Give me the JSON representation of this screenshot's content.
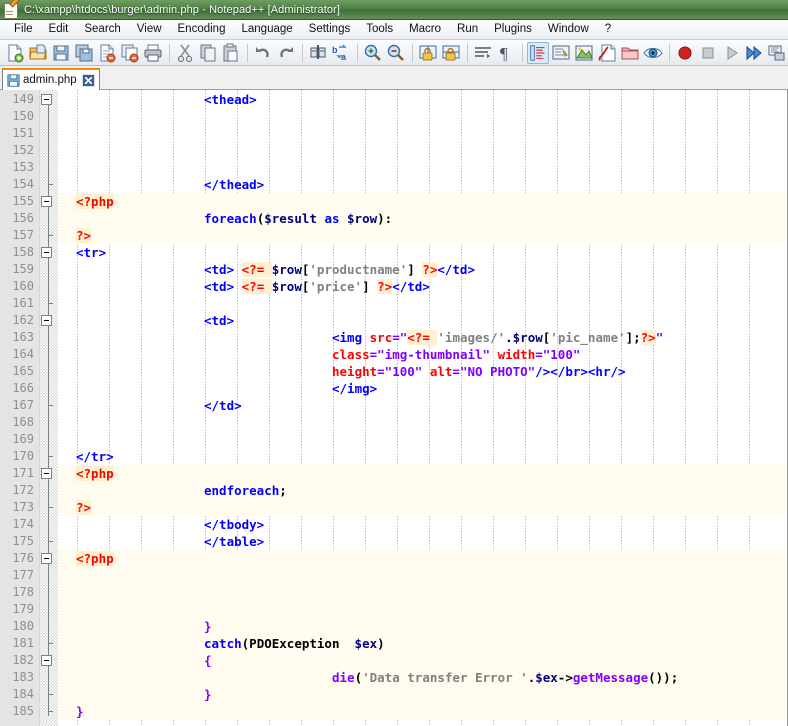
{
  "window": {
    "title": "C:\\xampp\\htdocs\\burger\\admin.php - Notepad++ [Administrator]",
    "app_icon": "notepad-plus-plus-icon",
    "titlebar_color": "#4e7f43"
  },
  "menubar": {
    "items": [
      {
        "label": "File",
        "name": "menu-file"
      },
      {
        "label": "Edit",
        "name": "menu-edit"
      },
      {
        "label": "Search",
        "name": "menu-search"
      },
      {
        "label": "View",
        "name": "menu-view"
      },
      {
        "label": "Encoding",
        "name": "menu-encoding"
      },
      {
        "label": "Language",
        "name": "menu-language"
      },
      {
        "label": "Settings",
        "name": "menu-settings"
      },
      {
        "label": "Tools",
        "name": "menu-tools"
      },
      {
        "label": "Macro",
        "name": "menu-macro"
      },
      {
        "label": "Run",
        "name": "menu-run"
      },
      {
        "label": "Plugins",
        "name": "menu-plugins"
      },
      {
        "label": "Window",
        "name": "menu-window"
      },
      {
        "label": "?",
        "name": "menu-help"
      }
    ]
  },
  "toolbar": {
    "buttons": [
      "new-file-icon",
      "open-file-icon",
      "save-icon",
      "save-all-icon",
      "close-file-icon",
      "close-all-files-icon",
      "print-icon",
      "sep",
      "cut-icon",
      "copy-icon",
      "paste-icon",
      "sep",
      "undo-icon",
      "redo-icon",
      "sep",
      "find-icon",
      "replace-icon",
      "sep",
      "zoom-in-icon",
      "zoom-out-icon",
      "sep",
      "sync-vertical-scroll-icon",
      "sync-horizontal-scroll-icon",
      "sep",
      "word-wrap-icon",
      "show-all-characters-icon",
      "sep",
      "indent-guide-icon",
      "user-defined-language-icon",
      "show-doc-map-icon",
      "function-list-icon",
      "folder-as-workspace-icon",
      "monitoring-icon",
      "sep",
      "record-macro-icon",
      "stop-recording-icon",
      "playback-icon",
      "run-macro-multiple-icon",
      "save-macro-icon",
      "sep",
      "run-icon"
    ]
  },
  "tabs": {
    "active_index": 0,
    "items": [
      {
        "label": "admin.php",
        "icon": "saved-file-icon",
        "close_icon": "close-tab-icon"
      }
    ]
  },
  "editor": {
    "first_line": 149,
    "fold_lines": [
      149,
      155,
      158,
      162,
      171,
      176,
      182
    ],
    "tick_lines": [
      154,
      157,
      161,
      167,
      170,
      173,
      175,
      181,
      184,
      185
    ],
    "php_background_lines": [
      155,
      156,
      157,
      171,
      172,
      173,
      176,
      177,
      178,
      179,
      180,
      181,
      182,
      183,
      184,
      185
    ],
    "lines": [
      {
        "n": 149,
        "indent": 4,
        "tokens": [
          {
            "t": "tag",
            "v": "<thead>"
          }
        ]
      },
      {
        "n": 150,
        "indent": 0,
        "tokens": []
      },
      {
        "n": 151,
        "indent": 0,
        "tokens": []
      },
      {
        "n": 152,
        "indent": 0,
        "tokens": []
      },
      {
        "n": 153,
        "indent": 0,
        "tokens": []
      },
      {
        "n": 154,
        "indent": 4,
        "tokens": [
          {
            "t": "tag",
            "v": "</thead>"
          }
        ]
      },
      {
        "n": 155,
        "indent": 0,
        "tokens": [
          {
            "t": "phptag",
            "v": "<?php"
          }
        ]
      },
      {
        "n": 156,
        "indent": 4,
        "tokens": [
          {
            "t": "kw",
            "v": "foreach"
          },
          {
            "t": "op",
            "v": "("
          },
          {
            "t": "var",
            "v": "$result"
          },
          {
            "t": "plain",
            "v": " "
          },
          {
            "t": "kw",
            "v": "as"
          },
          {
            "t": "plain",
            "v": " "
          },
          {
            "t": "var",
            "v": "$row"
          },
          {
            "t": "op",
            "v": "):"
          }
        ]
      },
      {
        "n": 157,
        "indent": 0,
        "tokens": [
          {
            "t": "phptag",
            "v": "?>"
          }
        ]
      },
      {
        "n": 158,
        "indent": 0,
        "tokens": [
          {
            "t": "tag",
            "v": "<tr>"
          }
        ]
      },
      {
        "n": 159,
        "indent": 4,
        "tokens": [
          {
            "t": "tag",
            "v": "<td> "
          },
          {
            "t": "phptag",
            "v": "<?= "
          },
          {
            "t": "var",
            "v": "$row"
          },
          {
            "t": "op",
            "v": "["
          },
          {
            "t": "str",
            "v": "'productname'"
          },
          {
            "t": "op",
            "v": "] "
          },
          {
            "t": "phptag",
            "v": "?>"
          },
          {
            "t": "tag",
            "v": "</td>"
          }
        ]
      },
      {
        "n": 160,
        "indent": 4,
        "tokens": [
          {
            "t": "tag",
            "v": "<td> "
          },
          {
            "t": "phptag",
            "v": "<?= "
          },
          {
            "t": "var",
            "v": "$row"
          },
          {
            "t": "op",
            "v": "["
          },
          {
            "t": "str",
            "v": "'price'"
          },
          {
            "t": "op",
            "v": "] "
          },
          {
            "t": "phptag",
            "v": "?>"
          },
          {
            "t": "tag",
            "v": "</td>"
          }
        ]
      },
      {
        "n": 161,
        "indent": 0,
        "tokens": []
      },
      {
        "n": 162,
        "indent": 4,
        "tokens": [
          {
            "t": "tag",
            "v": "<td>"
          }
        ]
      },
      {
        "n": 163,
        "indent": 8,
        "tokens": [
          {
            "t": "tag",
            "v": "<img "
          },
          {
            "t": "attr",
            "v": "src"
          },
          {
            "t": "attrval",
            "v": "=\""
          },
          {
            "t": "phptag",
            "v": "<?= "
          },
          {
            "t": "str",
            "v": "'images/'"
          },
          {
            "t": "op",
            "v": "."
          },
          {
            "t": "var",
            "v": "$row"
          },
          {
            "t": "op",
            "v": "["
          },
          {
            "t": "str",
            "v": "'pic_name'"
          },
          {
            "t": "op",
            "v": "];"
          },
          {
            "t": "phptag",
            "v": "?>"
          },
          {
            "t": "attrval",
            "v": "\""
          }
        ]
      },
      {
        "n": 164,
        "indent": 8,
        "tokens": [
          {
            "t": "attr",
            "v": "class"
          },
          {
            "t": "attrval",
            "v": "=\"img-thumbnail\""
          },
          {
            "t": "plain",
            "v": " "
          },
          {
            "t": "attr",
            "v": "width"
          },
          {
            "t": "attrval",
            "v": "=\"100\""
          }
        ]
      },
      {
        "n": 165,
        "indent": 8,
        "tokens": [
          {
            "t": "attr",
            "v": "height"
          },
          {
            "t": "attrval",
            "v": "=\"100\""
          },
          {
            "t": "plain",
            "v": " "
          },
          {
            "t": "attr",
            "v": "alt"
          },
          {
            "t": "attrval",
            "v": "=\"NO PHOTO\""
          },
          {
            "t": "tag",
            "v": "/></br><hr/>"
          }
        ]
      },
      {
        "n": 166,
        "indent": 8,
        "tokens": [
          {
            "t": "tag",
            "v": "</img>"
          }
        ]
      },
      {
        "n": 167,
        "indent": 4,
        "tokens": [
          {
            "t": "tag",
            "v": "</td>"
          }
        ]
      },
      {
        "n": 168,
        "indent": 0,
        "tokens": []
      },
      {
        "n": 169,
        "indent": 0,
        "tokens": []
      },
      {
        "n": 170,
        "indent": 0,
        "tokens": [
          {
            "t": "tag",
            "v": "</tr>"
          }
        ]
      },
      {
        "n": 171,
        "indent": 0,
        "tokens": [
          {
            "t": "phptag",
            "v": "<?php"
          }
        ]
      },
      {
        "n": 172,
        "indent": 4,
        "tokens": [
          {
            "t": "kw",
            "v": "endforeach"
          },
          {
            "t": "op",
            "v": ";"
          }
        ]
      },
      {
        "n": 173,
        "indent": 0,
        "tokens": [
          {
            "t": "phptag",
            "v": "?>"
          }
        ]
      },
      {
        "n": 174,
        "indent": 4,
        "tokens": [
          {
            "t": "tag",
            "v": "</tbody>"
          }
        ]
      },
      {
        "n": 175,
        "indent": 4,
        "tokens": [
          {
            "t": "tag",
            "v": "</table>"
          }
        ]
      },
      {
        "n": 176,
        "indent": 0,
        "tokens": [
          {
            "t": "phptag",
            "v": "<?php"
          }
        ]
      },
      {
        "n": 177,
        "indent": 0,
        "tokens": []
      },
      {
        "n": 178,
        "indent": 0,
        "tokens": []
      },
      {
        "n": 179,
        "indent": 0,
        "tokens": []
      },
      {
        "n": 180,
        "indent": 4,
        "tokens": [
          {
            "t": "brace",
            "v": "}"
          }
        ]
      },
      {
        "n": 181,
        "indent": 4,
        "tokens": [
          {
            "t": "kw",
            "v": "catch"
          },
          {
            "t": "op",
            "v": "("
          },
          {
            "t": "cls",
            "v": "PDOException"
          },
          {
            "t": "plain",
            "v": "  "
          },
          {
            "t": "var",
            "v": "$ex"
          },
          {
            "t": "op",
            "v": ")"
          }
        ]
      },
      {
        "n": 182,
        "indent": 4,
        "tokens": [
          {
            "t": "brace",
            "v": "{"
          }
        ]
      },
      {
        "n": 183,
        "indent": 8,
        "tokens": [
          {
            "t": "func",
            "v": "die"
          },
          {
            "t": "op",
            "v": "("
          },
          {
            "t": "str",
            "v": "'Data transfer Error '"
          },
          {
            "t": "op",
            "v": "."
          },
          {
            "t": "var",
            "v": "$ex"
          },
          {
            "t": "op",
            "v": "->"
          },
          {
            "t": "func",
            "v": "getMessage"
          },
          {
            "t": "op",
            "v": "());"
          }
        ]
      },
      {
        "n": 184,
        "indent": 4,
        "tokens": [
          {
            "t": "brace",
            "v": "}"
          }
        ]
      },
      {
        "n": 185,
        "indent": 0,
        "tokens": [
          {
            "t": "brace",
            "v": "}"
          }
        ]
      }
    ]
  },
  "colors": {
    "php_block_background": "#fffbef",
    "php_delimiter_highlight": "#fff0d0",
    "tag_blue": "#0000ff",
    "php_red": "#ff0000",
    "string_gray": "#808080",
    "variable_navy": "#000080",
    "attrval_purple": "#8000ff",
    "gutter_gray": "#e4e4e4",
    "tab_accent": "#f08a00"
  }
}
